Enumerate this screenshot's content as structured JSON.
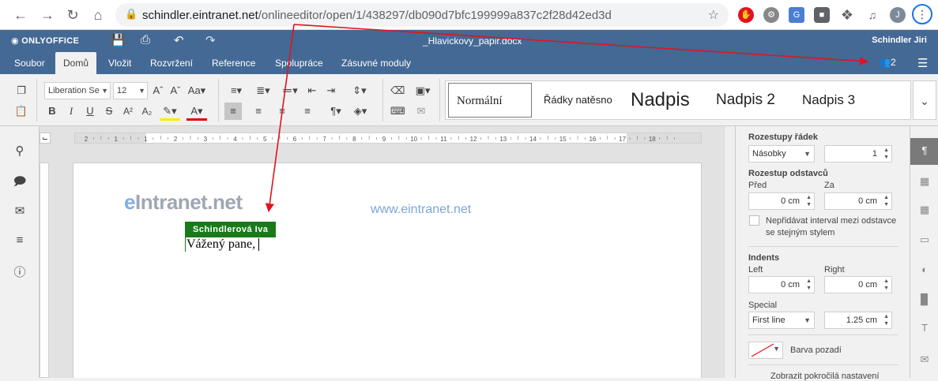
{
  "browser": {
    "url_host": "schindler.eintranet.net",
    "url_path": "/onlineeditor/open/1/438297/db090d7bfc199999a837c2f28d42ed3d",
    "profile_initial": "J",
    "icons": [
      "back-icon",
      "forward-icon",
      "reload-icon",
      "home-icon",
      "lock-icon",
      "star-icon",
      "puzzle-icon",
      "menu-icon"
    ]
  },
  "app": {
    "logo": "ONLYOFFICE",
    "doc_title": "_Hlavickovy_papir.docx",
    "user_name": "Schindler Jiri",
    "users_count": "2"
  },
  "tabs": [
    {
      "label": "Soubor"
    },
    {
      "label": "Domů"
    },
    {
      "label": "Vložit"
    },
    {
      "label": "Rozvržení"
    },
    {
      "label": "Reference"
    },
    {
      "label": "Spolupráce"
    },
    {
      "label": "Zásuvné moduly"
    }
  ],
  "toolbar": {
    "font_name": "Liberation Serif",
    "font_size": "12",
    "styles": [
      "Normální",
      "Řádky natěsno",
      "Nadpis",
      "Nadpis 2",
      "Nadpis 3"
    ]
  },
  "ruler": {
    "ticks": [
      "2",
      "1",
      "1",
      "2",
      "3",
      "4",
      "5",
      "6",
      "7",
      "8",
      "9",
      "10",
      "11",
      "12",
      "13",
      "14",
      "15",
      "16",
      "17",
      "18"
    ]
  },
  "document": {
    "logo_text_e": "e",
    "logo_text_rest": "Intranet.net",
    "website": "www.eintranet.net",
    "cursor_user": "Schindlerová Iva",
    "body_text": "Vážený pane,"
  },
  "paragraph_settings": {
    "line_spacing_title": "Rozestupy řádek",
    "line_spacing_type": "Násobky",
    "line_spacing_value": "1",
    "para_spacing_title": "Rozestup odstavců",
    "before_label": "Před",
    "after_label": "Za",
    "before_value": "0 cm",
    "after_value": "0 cm",
    "no_interval_label_1": "Nepřidávat interval mezi odstavce",
    "no_interval_label_2": "se stejným stylem",
    "indents_title": "Indents",
    "left_label": "Left",
    "right_label": "Right",
    "left_value": "0 cm",
    "right_value": "0 cm",
    "special_label": "Special",
    "special_type": "First line",
    "special_value": "1.25 cm",
    "bg_color_label": "Barva pozadí",
    "advanced_link": "Zobrazit pokročilá nastavení"
  },
  "colors": {
    "header_blue": "#446995",
    "user_green": "#1a7a1a",
    "annotation_red": "#e0141e"
  }
}
